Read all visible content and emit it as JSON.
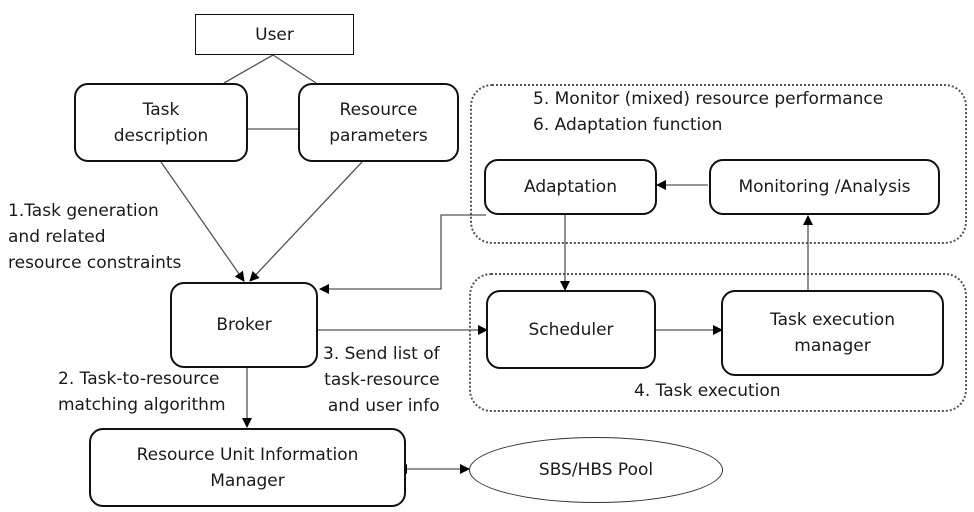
{
  "nodes": {
    "user": "User",
    "task_description": [
      "Task",
      "description"
    ],
    "resource_parameters": [
      "Resource",
      "parameters"
    ],
    "broker": "Broker",
    "resource_unit_manager": [
      "Resource Unit Information",
      "Manager"
    ],
    "pool": "SBS/HBS Pool",
    "adaptation": "Adaptation",
    "monitoring": "Monitoring /Analysis",
    "scheduler": "Scheduler",
    "task_exec_manager": [
      "Task execution",
      "manager"
    ]
  },
  "labels": {
    "step1": [
      "1.Task generation",
      "and related",
      "resource constraints"
    ],
    "step2": [
      "2. Task-to-resource",
      "matching algorithm"
    ],
    "step3": [
      "3. Send list of",
      "task-resource",
      "and user info"
    ],
    "step4": "4.  Task execution",
    "step5": "5.  Monitor (mixed) resource performance",
    "step6": "6.  Adaptation function"
  }
}
